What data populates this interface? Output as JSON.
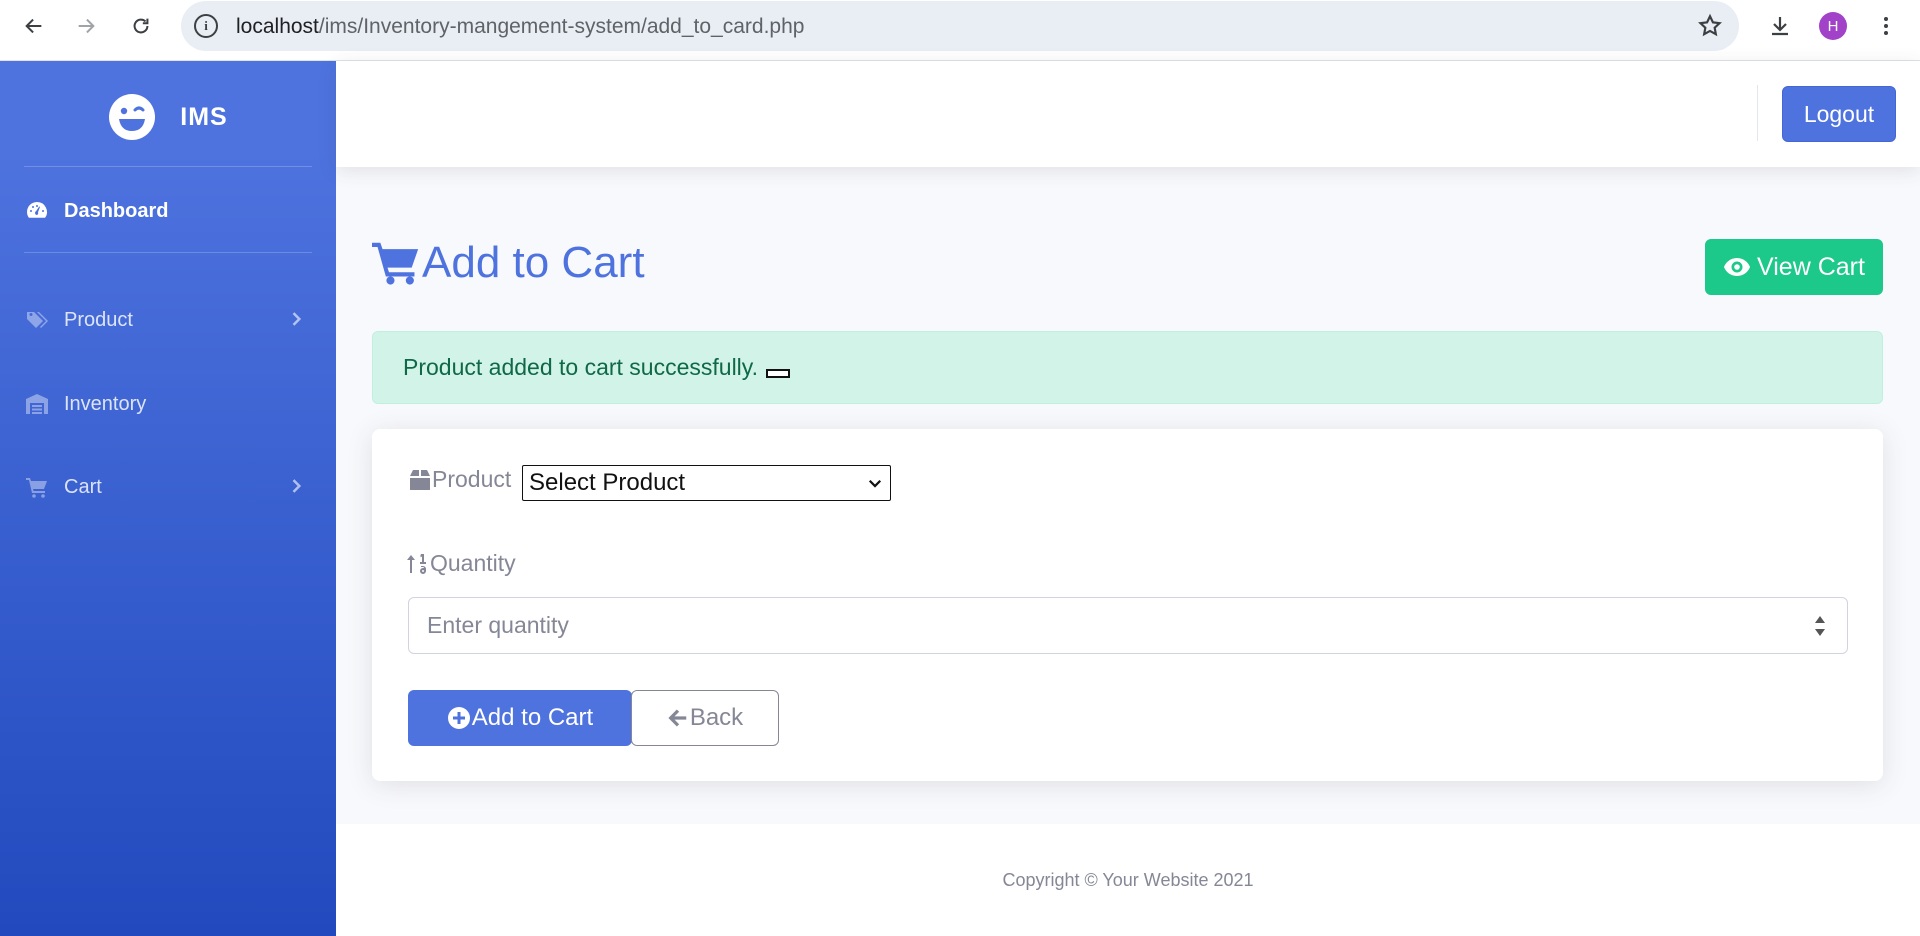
{
  "browser": {
    "url_host": "localhost",
    "url_path": "/ims/Inventory-mangement-system/add_to_card.php",
    "profile_initial": "H"
  },
  "sidebar": {
    "brand": "IMS",
    "items": [
      {
        "label": "Dashboard",
        "icon": "tachometer-icon",
        "active": true
      },
      {
        "label": "Product",
        "icon": "tags-icon",
        "has_submenu": true
      },
      {
        "label": "Inventory",
        "icon": "warehouse-icon"
      },
      {
        "label": "Cart",
        "icon": "cart-icon",
        "has_submenu": true
      }
    ]
  },
  "topbar": {
    "logout_label": "Logout"
  },
  "main": {
    "title": "Add to Cart",
    "view_cart_label": "View Cart",
    "alert": "Product added to cart successfully.",
    "product_label": "Product",
    "product_selected": "Select Product",
    "quantity_label": "Quantity",
    "quantity_placeholder": "Enter quantity",
    "add_button": "Add to Cart",
    "back_button": "Back"
  },
  "footer": {
    "text": "Copyright © Your Website 2021"
  },
  "colors": {
    "primary": "#4e73df",
    "success": "#1cc88a",
    "alert_bg": "#d2f4e8",
    "muted": "#858796"
  }
}
